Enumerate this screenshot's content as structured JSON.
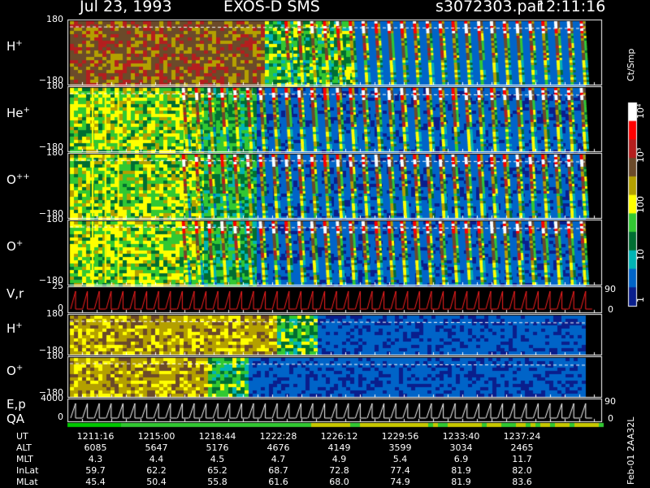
{
  "header": {
    "date": "Jul 23, 1993",
    "instrument": "EXOS-D SMS",
    "file": "s3072303.par",
    "time": "12:11:16"
  },
  "colorbar": {
    "units": "Ct/Smp",
    "labels": [
      "10⁴",
      "10³",
      "100",
      "10",
      "1"
    ],
    "colors": [
      "#ffffff",
      "#ff0000",
      "#b41e1e",
      "#6b4a2a",
      "#b4a000",
      "#ffff00",
      "#32c832",
      "#006e32",
      "#00b4b4",
      "#0064c8",
      "#0a1e8c"
    ]
  },
  "panels": [
    {
      "id": "h-plus-pitch",
      "label": "H",
      "sup": "+",
      "ytop": "180",
      "ybot": "−180"
    },
    {
      "id": "he-plus-pitch",
      "label": "He",
      "sup": "+",
      "ytop": "180",
      "ybot": "−180"
    },
    {
      "id": "o-plus-plus-pitch",
      "label": "O",
      "sup": "++",
      "ytop": "180",
      "ybot": "−180"
    },
    {
      "id": "o-plus-pitch",
      "label": "O",
      "sup": "+",
      "ytop": "180",
      "ybot": "−180"
    },
    {
      "id": "velocity",
      "label": "V,r",
      "sup": "",
      "ytop": "25",
      "ybot": "0",
      "rtop": "90",
      "rbot": "0"
    },
    {
      "id": "h-plus-angle",
      "label": "H",
      "sup": "+",
      "ytop": "180",
      "ybot": "−180"
    },
    {
      "id": "o-plus-angle",
      "label": "O",
      "sup": "+",
      "ytop": "180",
      "ybot": "−180"
    },
    {
      "id": "energy",
      "label": "E,p",
      "sup": "",
      "label2": "QA",
      "ytop": "4000",
      "ybot": "0",
      "rtop": "90",
      "rbot": "0"
    }
  ],
  "chart_data": {
    "type": "heatmap",
    "title": "Jul 23, 1993   EXOS-D SMS",
    "x": [
      "1211:16",
      "1215:00",
      "1218:44",
      "1222:28",
      "1226:12",
      "1229:56",
      "1233:40",
      "1237:24"
    ],
    "ylim": [
      -180,
      180
    ],
    "colorscale_labels": [
      "1",
      "10",
      "100",
      "10³",
      "10⁴"
    ]
  },
  "ephemeris": {
    "rows": [
      {
        "name": "UT",
        "values": [
          "1211:16",
          "1215:00",
          "1218:44",
          "1222:28",
          "1226:12",
          "1229:56",
          "1233:40",
          "1237:24"
        ]
      },
      {
        "name": "ALT",
        "values": [
          "6085",
          "5647",
          "5176",
          "4676",
          "4149",
          "3599",
          "3034",
          "2465"
        ]
      },
      {
        "name": "MLT",
        "values": [
          "4.3",
          "4.4",
          "4.5",
          "4.7",
          "4.9",
          "5.4",
          "6.9",
          "11.7"
        ]
      },
      {
        "name": "InLat",
        "values": [
          "59.7",
          "62.2",
          "65.2",
          "68.7",
          "72.8",
          "77.4",
          "81.9",
          "82.0"
        ]
      },
      {
        "name": "MLat",
        "values": [
          "45.4",
          "50.4",
          "55.8",
          "61.6",
          "68.0",
          "74.9",
          "81.9",
          "83.6"
        ]
      }
    ]
  },
  "footer": {
    "note": "Feb-01 2AA32L"
  }
}
